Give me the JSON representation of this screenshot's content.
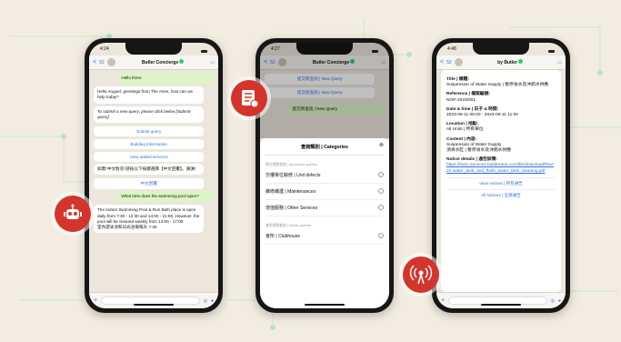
{
  "colors": {
    "accent": "#d3352c",
    "link": "#2f73d8",
    "outgoing": "#dcf5c5",
    "verified": "#25d366"
  },
  "phone1": {
    "time": "4:24",
    "back": "<",
    "unread": "52",
    "title": "Butler Concierge",
    "messages": [
      {
        "dir": "out",
        "text": "Hello there",
        "time": ""
      },
      {
        "dir": "in",
        "text": "Hello Anguel, greetings from The Aries, how can we help today?",
        "time": ""
      },
      {
        "dir": "in",
        "text": "To submit a new query, please click below [Submit-query]",
        "time": ""
      }
    ],
    "buttons": [
      "Submit query",
      "Building information",
      "View added services"
    ],
    "msg_zh": "如需*中文對答*請按以下按鍵選擇【中文回覆】。謝謝!",
    "zh_button": "中文回覆",
    "question": "What time does the swimming pool open?",
    "answer": "The Indoor Swimming Pool & Run Bath place is open daily from 7:30 - 12:30 and 14:00 - 21:00. However, the pool will be cleaned weekly from 14:00 - 17:00",
    "answer_zh": "室內游泳池和日光浴場每天 7:30"
  },
  "phone2": {
    "time": "4:27",
    "back": "<",
    "unread": "52",
    "title": "Butler Concierge",
    "top_items": [
      "提交新查詢 | New Query",
      "提交新查詢 | New Query"
    ],
    "new_query": "提交新查詢 | New Query",
    "sheet_title": "查詢類別 | Categories",
    "section1": "單位相關查詢 | Apartment queries",
    "options1": [
      "交樓單位執修 | Unit defects",
      "維修維護 | Maintenances",
      "增值服務 | Other Services"
    ],
    "section2": "會所相關查詢 | Estate queries",
    "options2": [
      "會所 | Clubhouse"
    ]
  },
  "phone3": {
    "time": "4:48",
    "back": "<",
    "unread": "52",
    "title": "by Butler",
    "fields": [
      {
        "label": "Title | 標題:",
        "value": "Suspension of Water Supply | 暫停食水及沖廁水供應"
      },
      {
        "label": "Reference | 檔案編號:",
        "value": "NOP-2023/001"
      },
      {
        "label": "Date & time | 日子 & 時間:",
        "value": "2023-09-11 09:00 - 2023-09-11 11:00"
      },
      {
        "label": "Location | 地點:",
        "value": "All Units | 所有單位"
      },
      {
        "label": "Content | 內容:",
        "value": "Suspension of Water Supply"
      },
      {
        "label": "",
        "value": "須清水缸 | 暫停食水及沖廁水供應"
      },
      {
        "label": "Notice details | 通告詳情:",
        "value": "https://fonic-services.builderaus.com/file/download/Rev/22-water_tank_and_flush_water_tank_cleaning.pdf"
      }
    ],
    "buttons": [
      "View notices | 所有通告",
      "All Notices | 全部通告"
    ]
  },
  "badges": {
    "left": "robot-icon",
    "middle": "checklist-icon",
    "right": "broadcast-icon"
  }
}
